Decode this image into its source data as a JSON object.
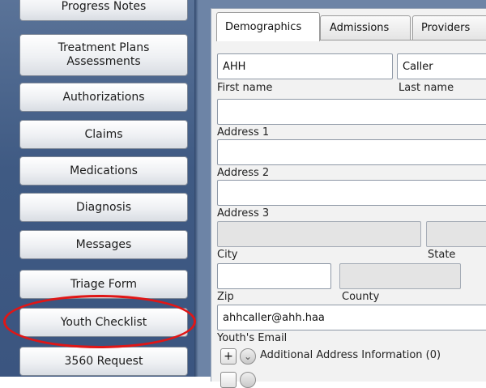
{
  "nav": {
    "items": [
      {
        "label": "Progress Notes"
      },
      {
        "label": "Treatment Plans Assessments"
      },
      {
        "label": "Authorizations"
      },
      {
        "label": "Claims"
      },
      {
        "label": "Medications"
      },
      {
        "label": "Diagnosis"
      },
      {
        "label": "Messages"
      },
      {
        "label": "Triage Form"
      },
      {
        "label": "Youth Checklist"
      },
      {
        "label": "3560 Request"
      }
    ]
  },
  "tabs": [
    {
      "label": "Demographics",
      "active": true
    },
    {
      "label": "Admissions"
    },
    {
      "label": "Providers"
    }
  ],
  "form": {
    "first_name": {
      "value": "AHH",
      "label": "First name"
    },
    "last_name": {
      "value": "Caller",
      "label": "Last name"
    },
    "address1": {
      "value": "",
      "label": "Address 1"
    },
    "address2": {
      "value": "",
      "label": "Address 2"
    },
    "address3": {
      "value": "",
      "label": "Address 3"
    },
    "city": {
      "value": "",
      "label": "City"
    },
    "state": {
      "value": "",
      "label": "State"
    },
    "zip": {
      "value": "",
      "label": "Zip"
    },
    "county": {
      "value": "",
      "label": "County"
    },
    "email": {
      "value": "ahhcaller@ahh.haa",
      "label": "Youth's Email"
    },
    "additional_address": {
      "label": "Additional Address Information (0)",
      "plus": "+",
      "expand": "⌄"
    }
  },
  "annotation": {
    "color": "#e01616",
    "target": "Youth Checklist"
  }
}
